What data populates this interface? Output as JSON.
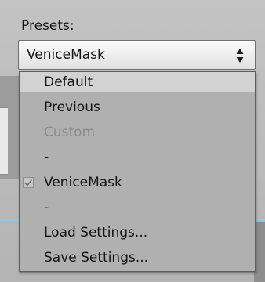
{
  "presets": {
    "label": "Presets:",
    "selected_value": "VeniceMask"
  },
  "menu": {
    "items": [
      {
        "label": "Default",
        "state": "highlighted"
      },
      {
        "label": "Previous",
        "state": "normal"
      },
      {
        "label": "Custom",
        "state": "disabled"
      },
      {
        "label": "-",
        "state": "separator"
      },
      {
        "label": "VeniceMask",
        "state": "checked"
      },
      {
        "label": "-",
        "state": "separator"
      },
      {
        "label": "Load Settings...",
        "state": "normal"
      },
      {
        "label": "Save Settings...",
        "state": "normal"
      }
    ]
  },
  "icons": {
    "select_arrows": "up-down-arrows-icon",
    "checkmark": "checkmark-icon"
  },
  "colors": {
    "menu_background": "#b0b0b0",
    "menu_highlight": "#d2d2d2",
    "disabled_text": "#8a8a8a",
    "accent_line": "#8fc8e8"
  }
}
